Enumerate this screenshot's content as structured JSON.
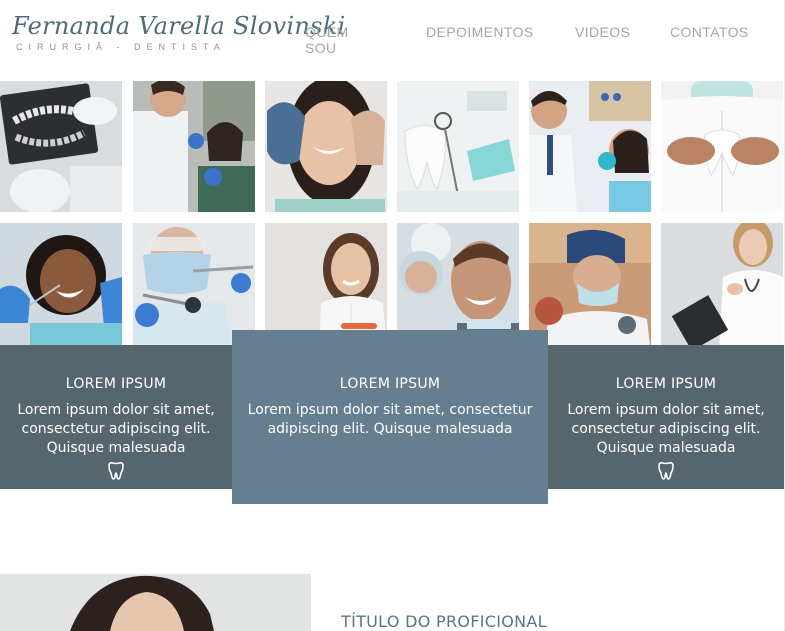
{
  "header": {
    "logo_name": "Fernanda Varella Slovinski",
    "logo_subtitle": "CIRURGIÃ - DENTISTA",
    "nav": [
      "QUEM SOU",
      "DEPOIMENTOS",
      "VIDEOS",
      "CONTATOS"
    ]
  },
  "gallery": {
    "row1": [
      "dental-xray-photo",
      "dentist-with-patient-photo",
      "smiling-woman-heart-hands-photo",
      "tooth-model-and-mirror-photo",
      "dentist-examining-patient-photo",
      "doctor-holding-tooth-model-photo"
    ],
    "row2": [
      "laughing-patient-photo",
      "masked-dentist-with-tools-photo",
      "woman-smiling-photo",
      "smiling-man-in-chair-photo",
      "dentist-in-blue-cap-photo",
      "doctor-with-clipboard-photo"
    ]
  },
  "features": [
    {
      "title": "LOREM IPSUM",
      "text": "Lorem ipsum dolor sit amet, consectetur adipiscing elit. Quisque malesuada",
      "icon": "tooth-icon"
    },
    {
      "title": "LOREM IPSUM",
      "text": "Lorem ipsum dolor sit amet, consectetur adipiscing elit. Quisque malesuada"
    },
    {
      "title": "LOREM IPSUM",
      "text": "Lorem ipsum dolor sit amet, consectetur adipiscing elit. Quisque malesuada",
      "icon": "tooth-icon"
    }
  ],
  "profile": {
    "title": "TÍTULO DO PROFICIONAL"
  },
  "colors": {
    "feature_dark": "#56666f",
    "feature_mid": "#667f90",
    "brand": "#4e6b7d",
    "nav_text": "#a0a7ad"
  }
}
